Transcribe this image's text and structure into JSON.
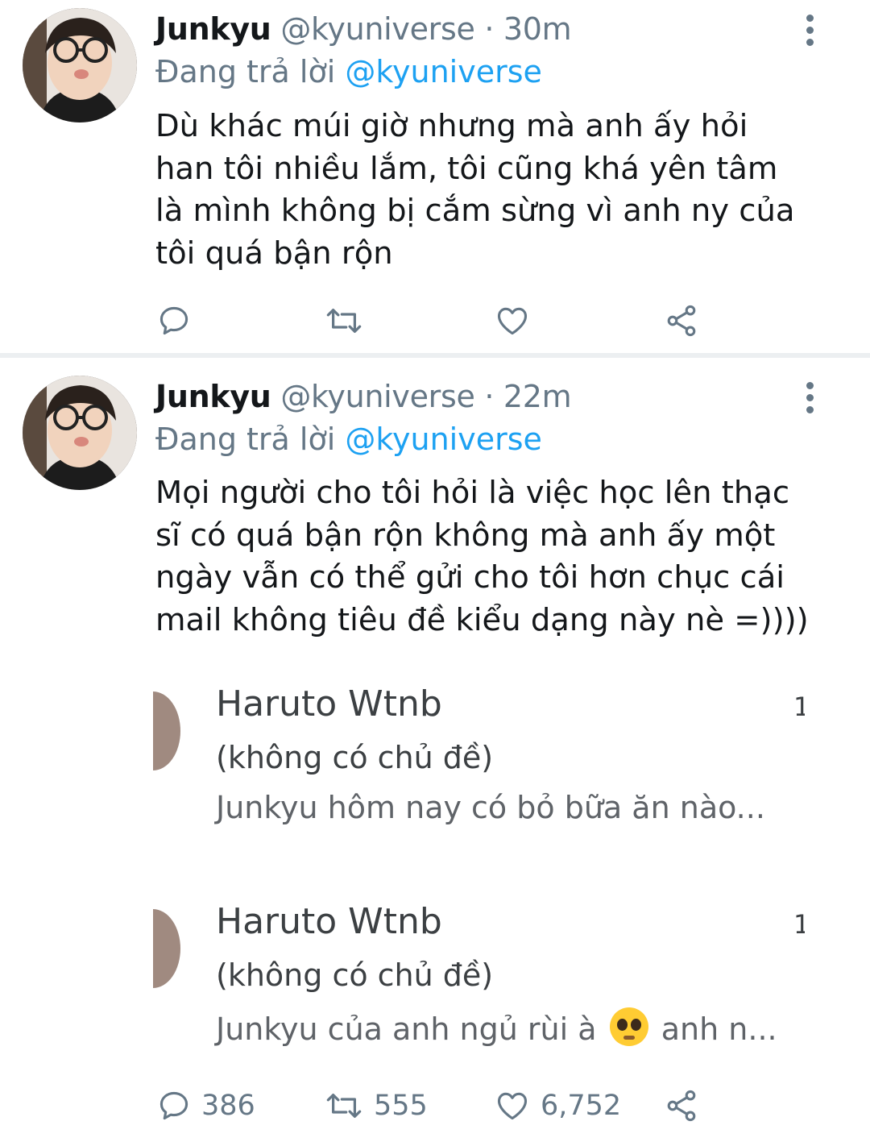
{
  "tweets": [
    {
      "name": "Junkyu",
      "handle": "@kyuniverse",
      "time": "30m",
      "separator": "·",
      "replying_prefix": "Đang trả lời",
      "replying_handle": "@kyuniverse",
      "text_lines": [
        "Dù khác múi giờ nhưng mà anh ấy hỏi",
        "han tôi nhiều lắm, tôi cũng khá yên tâm",
        "là mình không bị cắm sừng vì anh ny của",
        "tôi quá bận rộn"
      ],
      "actions": {
        "replies": "",
        "retweets": "",
        "likes": ""
      }
    },
    {
      "name": "Junkyu",
      "handle": "@kyuniverse",
      "time": "22m",
      "separator": "·",
      "replying_prefix": "Đang trả lời",
      "replying_handle": "@kyuniverse",
      "text_lines": [
        "Mọi người cho tôi hỏi là việc học lên thạc",
        "sĩ có quá bận rộn không mà anh ấy một",
        "ngày vẫn có thể gửi cho tôi hơn chục cái",
        "mail không tiêu đề kiểu dạng này nè =))))"
      ],
      "emails": [
        {
          "sender": "Haruto Wtnb",
          "time": "1",
          "subject": "(không có chủ đề)",
          "preview": "Junkyu hôm nay có bỏ bữa ăn nào..."
        },
        {
          "sender": "Haruto Wtnb",
          "time": "1",
          "subject": "(không có chủ đề)",
          "preview_before": "Junkyu của anh ngủ rùi à",
          "preview_emoji": "pleading-face-emoji",
          "preview_after": "anh n..."
        }
      ],
      "actions": {
        "replies": "386",
        "retweets": "555",
        "likes": "6,752"
      }
    }
  ],
  "colors": {
    "text": "#14171a",
    "secondary": "#657786",
    "link": "#1da1f2",
    "divider": "#eceff1"
  },
  "icons": [
    "reply-icon",
    "retweet-icon",
    "like-icon",
    "share-icon",
    "more-vertical-icon"
  ]
}
